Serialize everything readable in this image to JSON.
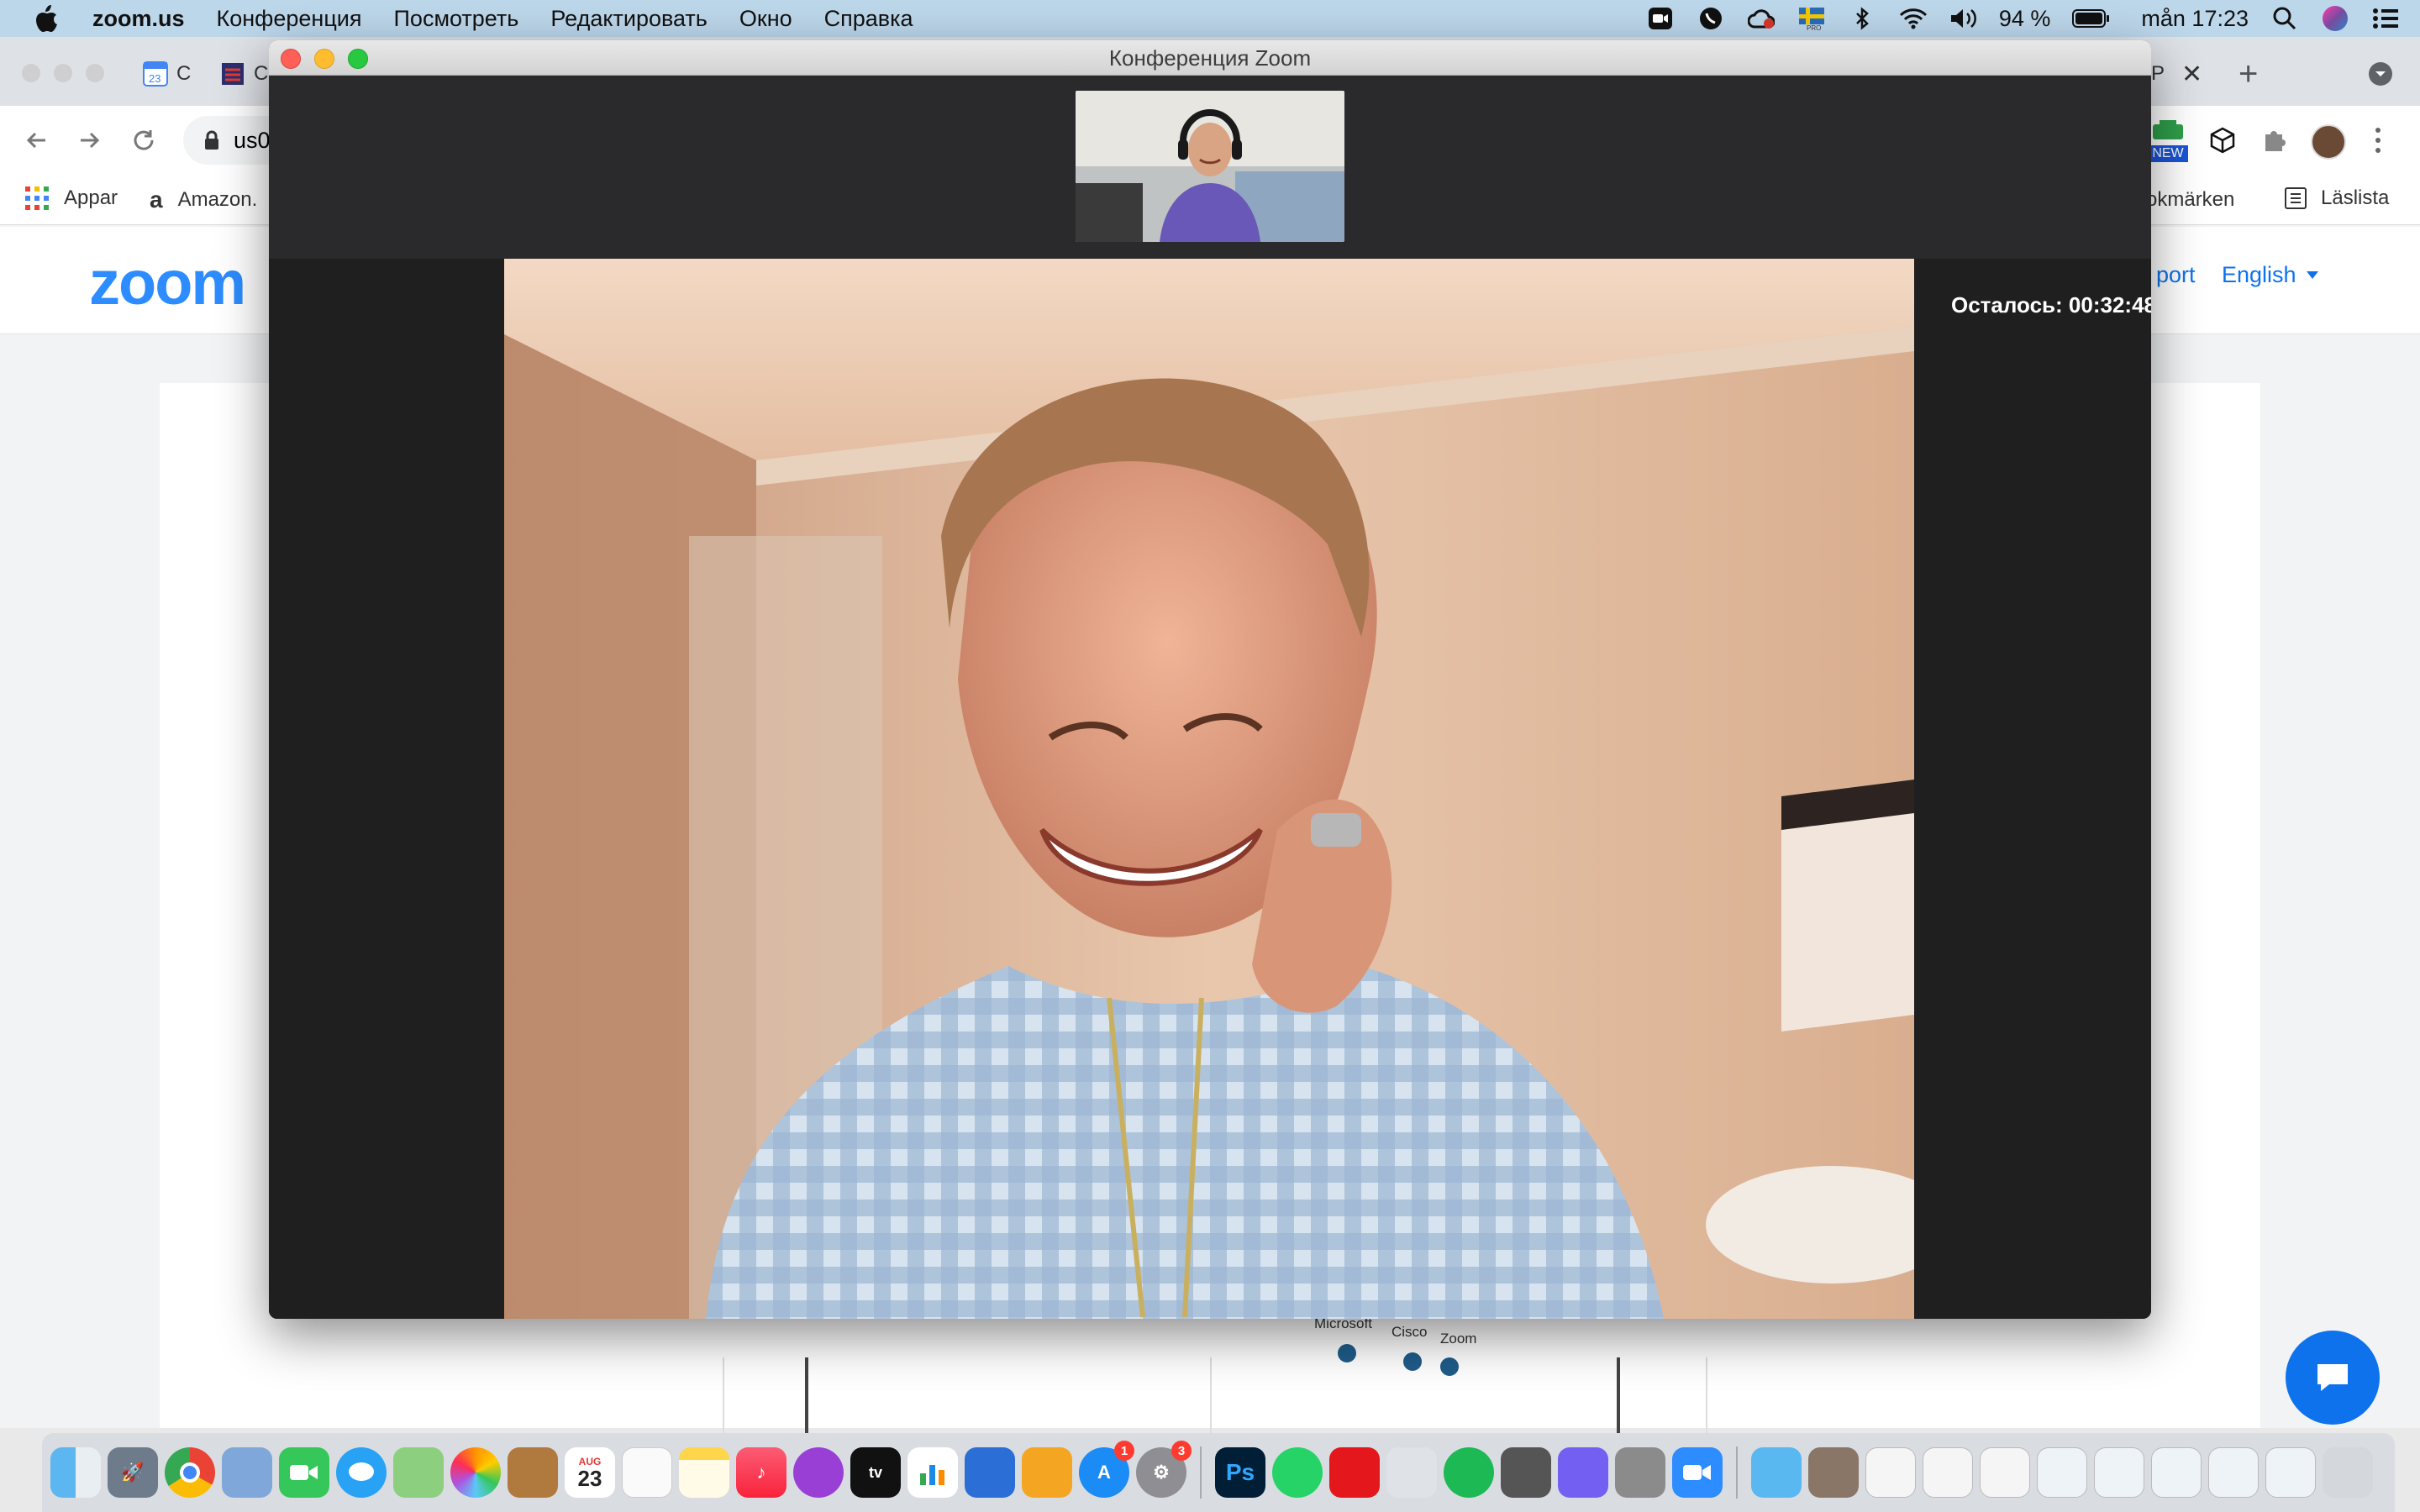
{
  "menubar": {
    "app_name": "zoom.us",
    "menus": [
      "Конференция",
      "Посмотреть",
      "Редактировать",
      "Окно",
      "Справка"
    ],
    "battery": "94 %",
    "clock": "mån 17:23"
  },
  "browser": {
    "tab_partial_1": "C",
    "tab_partial_2": "C",
    "tab_partial_right": "P",
    "address_partial": "us0",
    "bookmarks": {
      "apps": "Appar",
      "amazon": "Amazon.",
      "other": "okmärken",
      "reading_list": "Läslista"
    },
    "extension_badge": "NEW"
  },
  "site": {
    "logo": "zoom",
    "support_partial": "port",
    "language": "English",
    "chart_labels": [
      "Microsoft",
      "Cisco",
      "Zoom"
    ]
  },
  "zoom_window": {
    "title": "Конференция Zoom",
    "time_remaining": "Осталось: 00:32:48"
  },
  "dock": {
    "calendar_month": "AUG",
    "calendar_day": "23",
    "app_store_badge": "1",
    "settings_badge": "3",
    "photoshop_label": "Ps"
  }
}
